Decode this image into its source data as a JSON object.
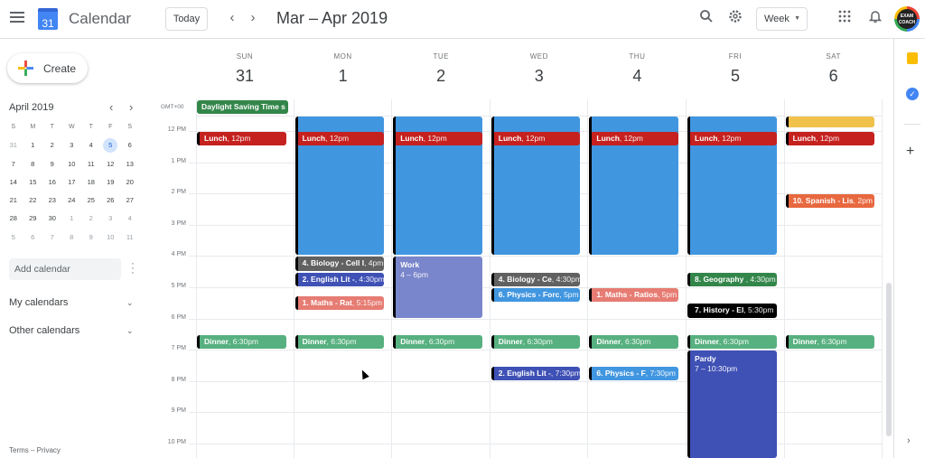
{
  "header": {
    "app_title": "Calendar",
    "logo_day": "31",
    "today_label": "Today",
    "prev_icon": "‹",
    "next_icon": "›",
    "date_range": "Mar – Apr 2019",
    "search_icon": "search-icon",
    "settings_icon": "gear-icon",
    "view_select": "Week",
    "apps_icon": "apps-grid-icon",
    "notifications_icon": "bell-icon",
    "avatar_text": "EXAM COACH"
  },
  "sidebar": {
    "create_label": "Create",
    "mini_calendar": {
      "title": "April 2019",
      "weekdays": [
        "S",
        "M",
        "T",
        "W",
        "T",
        "F",
        "S"
      ],
      "weeks": [
        [
          {
            "d": "31",
            "o": true
          },
          {
            "d": "1"
          },
          {
            "d": "2"
          },
          {
            "d": "3"
          },
          {
            "d": "4"
          },
          {
            "d": "5",
            "today": true
          },
          {
            "d": "6"
          }
        ],
        [
          {
            "d": "7"
          },
          {
            "d": "8"
          },
          {
            "d": "9"
          },
          {
            "d": "10"
          },
          {
            "d": "11"
          },
          {
            "d": "12"
          },
          {
            "d": "13"
          }
        ],
        [
          {
            "d": "14"
          },
          {
            "d": "15"
          },
          {
            "d": "16"
          },
          {
            "d": "17"
          },
          {
            "d": "18"
          },
          {
            "d": "19"
          },
          {
            "d": "20"
          }
        ],
        [
          {
            "d": "21"
          },
          {
            "d": "22"
          },
          {
            "d": "23"
          },
          {
            "d": "24"
          },
          {
            "d": "25"
          },
          {
            "d": "26"
          },
          {
            "d": "27"
          }
        ],
        [
          {
            "d": "28"
          },
          {
            "d": "29"
          },
          {
            "d": "30"
          },
          {
            "d": "1",
            "o": true
          },
          {
            "d": "2",
            "o": true
          },
          {
            "d": "3",
            "o": true
          },
          {
            "d": "4",
            "o": true
          }
        ],
        [
          {
            "d": "5",
            "o": true
          },
          {
            "d": "6",
            "o": true
          },
          {
            "d": "7",
            "o": true
          },
          {
            "d": "8",
            "o": true
          },
          {
            "d": "9",
            "o": true
          },
          {
            "d": "10",
            "o": true
          },
          {
            "d": "11",
            "o": true
          }
        ]
      ]
    },
    "add_calendar_placeholder": "Add calendar",
    "my_calendars": "My calendars",
    "other_calendars": "Other calendars",
    "footer": "Terms – Privacy"
  },
  "grid": {
    "timezone": "GMT+00",
    "days": [
      {
        "dow": "SUN",
        "num": "31"
      },
      {
        "dow": "MON",
        "num": "1"
      },
      {
        "dow": "TUE",
        "num": "2"
      },
      {
        "dow": "WED",
        "num": "3"
      },
      {
        "dow": "THU",
        "num": "4"
      },
      {
        "dow": "FRI",
        "num": "5"
      },
      {
        "dow": "SAT",
        "num": "6"
      }
    ],
    "hours": [
      "12 PM",
      "1 PM",
      "2 PM",
      "3 PM",
      "4 PM",
      "5 PM",
      "6 PM",
      "7 PM",
      "8 PM",
      "9 PM",
      "10 PM"
    ],
    "all_day_events": [
      {
        "day": 0,
        "title": "Daylight Saving Time s",
        "color": "#33864a"
      }
    ],
    "events": [
      {
        "day": 1,
        "start": 11.5,
        "end": 16,
        "title": "",
        "time": "",
        "color": "#4196e0",
        "block": true
      },
      {
        "day": 2,
        "start": 11.5,
        "end": 16,
        "title": "",
        "time": "",
        "color": "#4196e0",
        "block": true
      },
      {
        "day": 3,
        "start": 11.5,
        "end": 16,
        "title": "",
        "time": "",
        "color": "#4196e0",
        "block": true
      },
      {
        "day": 4,
        "start": 11.5,
        "end": 16,
        "title": "",
        "time": "",
        "color": "#4196e0",
        "block": true
      },
      {
        "day": 5,
        "start": 11.5,
        "end": 16,
        "title": "",
        "time": "",
        "color": "#4196e0",
        "block": true
      },
      {
        "day": 6,
        "start": 11.5,
        "end": 11.9,
        "title": "",
        "time": "",
        "color": "#f0c14b",
        "block": true
      },
      {
        "day": 0,
        "start": 12,
        "end": 12.5,
        "title": "Lunch",
        "time": "12pm",
        "color": "#c5221f"
      },
      {
        "day": 1,
        "start": 12,
        "end": 12.5,
        "title": "Lunch",
        "time": "12pm",
        "color": "#c5221f"
      },
      {
        "day": 2,
        "start": 12,
        "end": 12.5,
        "title": "Lunch",
        "time": "12pm",
        "color": "#c5221f"
      },
      {
        "day": 3,
        "start": 12,
        "end": 12.5,
        "title": "Lunch",
        "time": "12pm",
        "color": "#c5221f"
      },
      {
        "day": 4,
        "start": 12,
        "end": 12.5,
        "title": "Lunch",
        "time": "12pm",
        "color": "#c5221f"
      },
      {
        "day": 5,
        "start": 12,
        "end": 12.5,
        "title": "Lunch",
        "time": "12pm",
        "color": "#c5221f"
      },
      {
        "day": 6,
        "start": 12,
        "end": 12.5,
        "title": "Lunch",
        "time": "12pm",
        "color": "#c5221f"
      },
      {
        "day": 6,
        "start": 14,
        "end": 14.5,
        "title": "10. Spanish - Lis",
        "time": "2pm",
        "color": "#e8683f"
      },
      {
        "day": 1,
        "start": 16,
        "end": 16.5,
        "title": "4. Biology - Cell I",
        "time": "4pm",
        "color": "#616161"
      },
      {
        "day": 1,
        "start": 16.5,
        "end": 17,
        "title": "2. English Lit -",
        "time": "4:30pm",
        "color": "#3f51b5"
      },
      {
        "day": 1,
        "start": 17.25,
        "end": 17.75,
        "title": "1. Maths - Rat",
        "time": "5:15pm",
        "color": "#e67c73"
      },
      {
        "day": 2,
        "start": 16,
        "end": 18,
        "title": "Work",
        "time": "4 – 6pm",
        "color": "#7986cb",
        "block": true,
        "multiline": true
      },
      {
        "day": 3,
        "start": 16.5,
        "end": 17,
        "title": "4. Biology - Ce",
        "time": "4:30pm",
        "color": "#616161"
      },
      {
        "day": 3,
        "start": 17,
        "end": 17.5,
        "title": "6. Physics - Forc",
        "time": "5pm",
        "color": "#4196e0"
      },
      {
        "day": 4,
        "start": 17,
        "end": 17.5,
        "title": "1. Maths - Ratios",
        "time": "5pm",
        "color": "#e67c73"
      },
      {
        "day": 5,
        "start": 16.5,
        "end": 17,
        "title": "8. Geography ",
        "time": "4:30pm",
        "color": "#33864a"
      },
      {
        "day": 5,
        "start": 17.5,
        "end": 18,
        "title": "7. History - El",
        "time": "5:30pm",
        "color": "#000000"
      },
      {
        "day": 0,
        "start": 18.5,
        "end": 19,
        "title": "Dinner",
        "time": "6:30pm",
        "color": "#57b07f"
      },
      {
        "day": 1,
        "start": 18.5,
        "end": 19,
        "title": "Dinner",
        "time": "6:30pm",
        "color": "#57b07f"
      },
      {
        "day": 2,
        "start": 18.5,
        "end": 19,
        "title": "Dinner",
        "time": "6:30pm",
        "color": "#57b07f"
      },
      {
        "day": 3,
        "start": 18.5,
        "end": 19,
        "title": "Dinner",
        "time": "6:30pm",
        "color": "#57b07f"
      },
      {
        "day": 4,
        "start": 18.5,
        "end": 19,
        "title": "Dinner",
        "time": "6:30pm",
        "color": "#57b07f"
      },
      {
        "day": 5,
        "start": 18.5,
        "end": 19,
        "title": "Dinner",
        "time": "6:30pm",
        "color": "#57b07f"
      },
      {
        "day": 6,
        "start": 18.5,
        "end": 19,
        "title": "Dinner",
        "time": "6:30pm",
        "color": "#57b07f"
      },
      {
        "day": 3,
        "start": 19.5,
        "end": 20,
        "title": "2. English Lit -",
        "time": "7:30pm",
        "color": "#3f51b5"
      },
      {
        "day": 4,
        "start": 19.5,
        "end": 20,
        "title": "6. Physics - F",
        "time": "7:30pm",
        "color": "#4196e0"
      },
      {
        "day": 5,
        "start": 19,
        "end": 22.5,
        "title": "Pardy",
        "time": "7 – 10:30pm",
        "color": "#3f51b5",
        "block": true,
        "multiline": true
      }
    ]
  },
  "right_panel": {
    "keep_icon": "keep-icon",
    "tasks_icon": "tasks-icon",
    "add_icon": "+",
    "expand_icon": "›"
  }
}
